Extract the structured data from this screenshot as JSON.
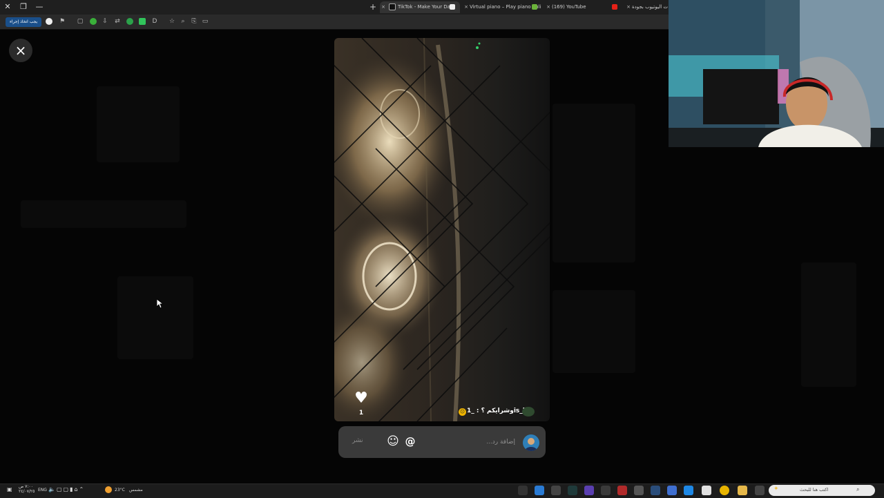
{
  "browser": {
    "tabs": [
      {
        "title": "TikTok - Make Your Day",
        "active": true
      },
      {
        "title": "Virtual piano – Play piano onli",
        "active": false
      },
      {
        "title": "(169) YouTube",
        "active": false
      },
      {
        "title": "ت اليوتيوب بجودة",
        "active": false
      }
    ],
    "action_button": "يجب اتخاذ إجراء",
    "close_glyph": "×"
  },
  "story": {
    "like_count": "1",
    "comment_username": "_1is_k",
    "comment_text": "وشرايكم ؟",
    "comment_sep": ":"
  },
  "reply": {
    "placeholder": "إضافة رد...",
    "send_label": "نشر",
    "mention_symbol": "@",
    "emoji_symbol": "☺"
  },
  "taskbar": {
    "temperature": "23°C",
    "weather": "مشمس",
    "language": "ENG",
    "time": "٧:٠٠ ص",
    "date": "٢٤/٠٧/٢٥",
    "search_placeholder": "اكتب هنا للبحث"
  },
  "colors": {
    "action_button": "#1a4f8a",
    "reply_bar": "#3a3a3a",
    "webcam_light": "#4fd6e0"
  }
}
